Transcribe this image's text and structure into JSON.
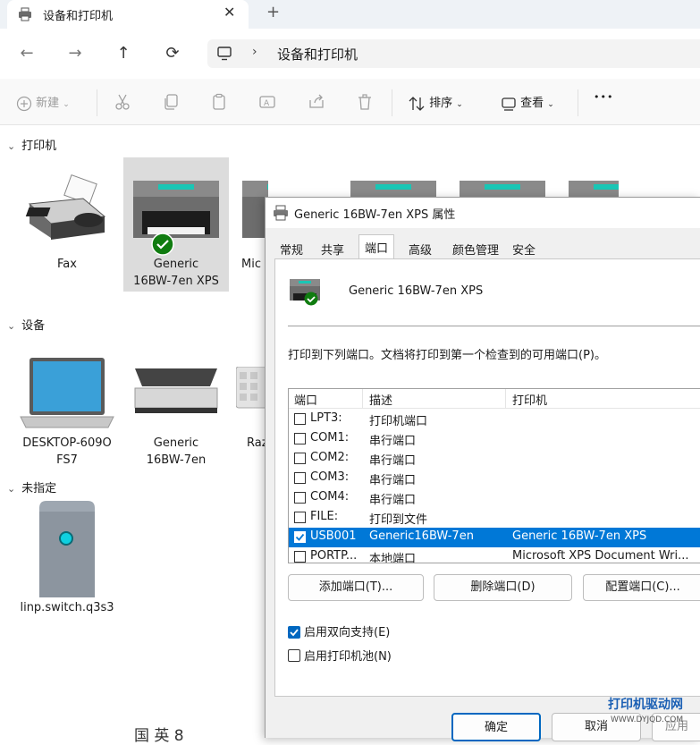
{
  "window": {
    "tab_title": "设备和打印机",
    "close_glyph": "✕",
    "new_tab_glyph": "+"
  },
  "nav": {
    "back": "←",
    "forward": "→",
    "up": "↑",
    "refresh": "⟳",
    "separator": "›",
    "breadcrumb": "设备和打印机"
  },
  "toolbar": {
    "new_label": "新建",
    "sort_label": "排序",
    "view_label": "查看",
    "more_glyph": "•••"
  },
  "sections": {
    "printers": "打印机",
    "devices": "设备",
    "unspecified": "未指定"
  },
  "printers": [
    {
      "line1": "Fax",
      "line2": ""
    },
    {
      "line1": "Generic",
      "line2": "16BW-7en XPS"
    },
    {
      "line1": "Mic",
      "line2": ""
    }
  ],
  "devices": [
    {
      "line1": "DESKTOP-609O",
      "line2": "FS7"
    },
    {
      "line1": "Generic",
      "line2": "16BW-7en"
    },
    {
      "line1": "Raz",
      "line2": ""
    }
  ],
  "unspecified": [
    {
      "line1": "linp.switch.q3s3"
    }
  ],
  "partial_text": "国 英 8",
  "dialog": {
    "title": "Generic 16BW-7en XPS 属性",
    "tabs": [
      "常规",
      "共享",
      "端口",
      "高级",
      "颜色管理",
      "安全"
    ],
    "active_tab": "端口",
    "printer_name": "Generic 16BW-7en XPS",
    "description": "打印到下列端口。文档将打印到第一个检查到的可用端口(P)。",
    "columns": [
      "端口",
      "描述",
      "打印机"
    ],
    "ports": [
      {
        "port": "LPT3:",
        "desc": "打印机端口",
        "printer": "",
        "checked": false
      },
      {
        "port": "COM1:",
        "desc": "串行端口",
        "printer": "",
        "checked": false
      },
      {
        "port": "COM2:",
        "desc": "串行端口",
        "printer": "",
        "checked": false
      },
      {
        "port": "COM3:",
        "desc": "串行端口",
        "printer": "",
        "checked": false
      },
      {
        "port": "COM4:",
        "desc": "串行端口",
        "printer": "",
        "checked": false
      },
      {
        "port": "FILE:",
        "desc": "打印到文件",
        "printer": "",
        "checked": false
      },
      {
        "port": "USB001",
        "desc": "Generic16BW-7en",
        "printer": "Generic 16BW-7en XPS",
        "checked": true
      },
      {
        "port": "PORTP...",
        "desc": "本地端口",
        "printer": "Microsoft XPS Document Wri...",
        "checked": false
      }
    ],
    "add_port": "添加端口(T)...",
    "delete_port": "删除端口(D)",
    "configure_port": "配置端口(C)...",
    "bidirectional": "启用双向支持(E)",
    "bidirectional_checked": true,
    "pooling": "启用打印机池(N)",
    "pooling_checked": false,
    "ok": "确定",
    "cancel": "取消",
    "apply": "应用"
  },
  "watermark": {
    "line1": "打印机驱动网",
    "line2": "WWW.DYJQD.COM"
  },
  "colors": {
    "selection": "#0078d7",
    "accent": "#0067c0",
    "success_badge": "#107c10"
  }
}
